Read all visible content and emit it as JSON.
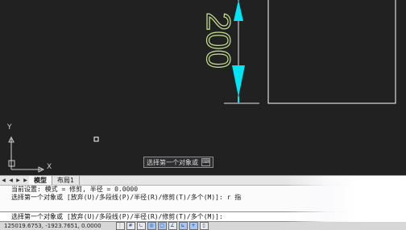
{
  "canvas": {
    "dimension_text": "200",
    "axis_x_label": "X",
    "axis_y_label": "Y"
  },
  "tooltip": {
    "text": "选择第一个对象或",
    "key_icon": "keyboard-icon"
  },
  "tabs": {
    "nav_first": "◀",
    "nav_prev": "◀",
    "nav_next": "▶",
    "nav_last": "▶",
    "items": [
      {
        "label": "模型",
        "active": true
      },
      {
        "label": "布局1",
        "active": false
      }
    ]
  },
  "command": {
    "history_line1": "当前设置: 模式 = 修剪, 半径 = 0.0000",
    "history_line2": "选择第一个对象或 [放弃(U)/多段线(P)/半径(R)/修剪(T)/多个(M)]: r 指",
    "prompt": "选择第一个对象或 [放弃(U)/多段线(P)/半径(R)/修剪(T)/多个(M)]:",
    "input_value": ""
  },
  "status": {
    "coords": "125019.6753, -1923.7651, 0.0000",
    "icons": [
      "snap-icon",
      "grid-icon",
      "ortho-icon",
      "polar-icon",
      "osnap-icon",
      "otrack-icon",
      "ducs-icon",
      "dyn-icon",
      "lineweight-icon"
    ]
  },
  "colors": {
    "canvas_bg": "#212121",
    "dimension_color": "#00e5f5",
    "geometry_color": "#ffffff",
    "text_color": "#c5e08f"
  }
}
